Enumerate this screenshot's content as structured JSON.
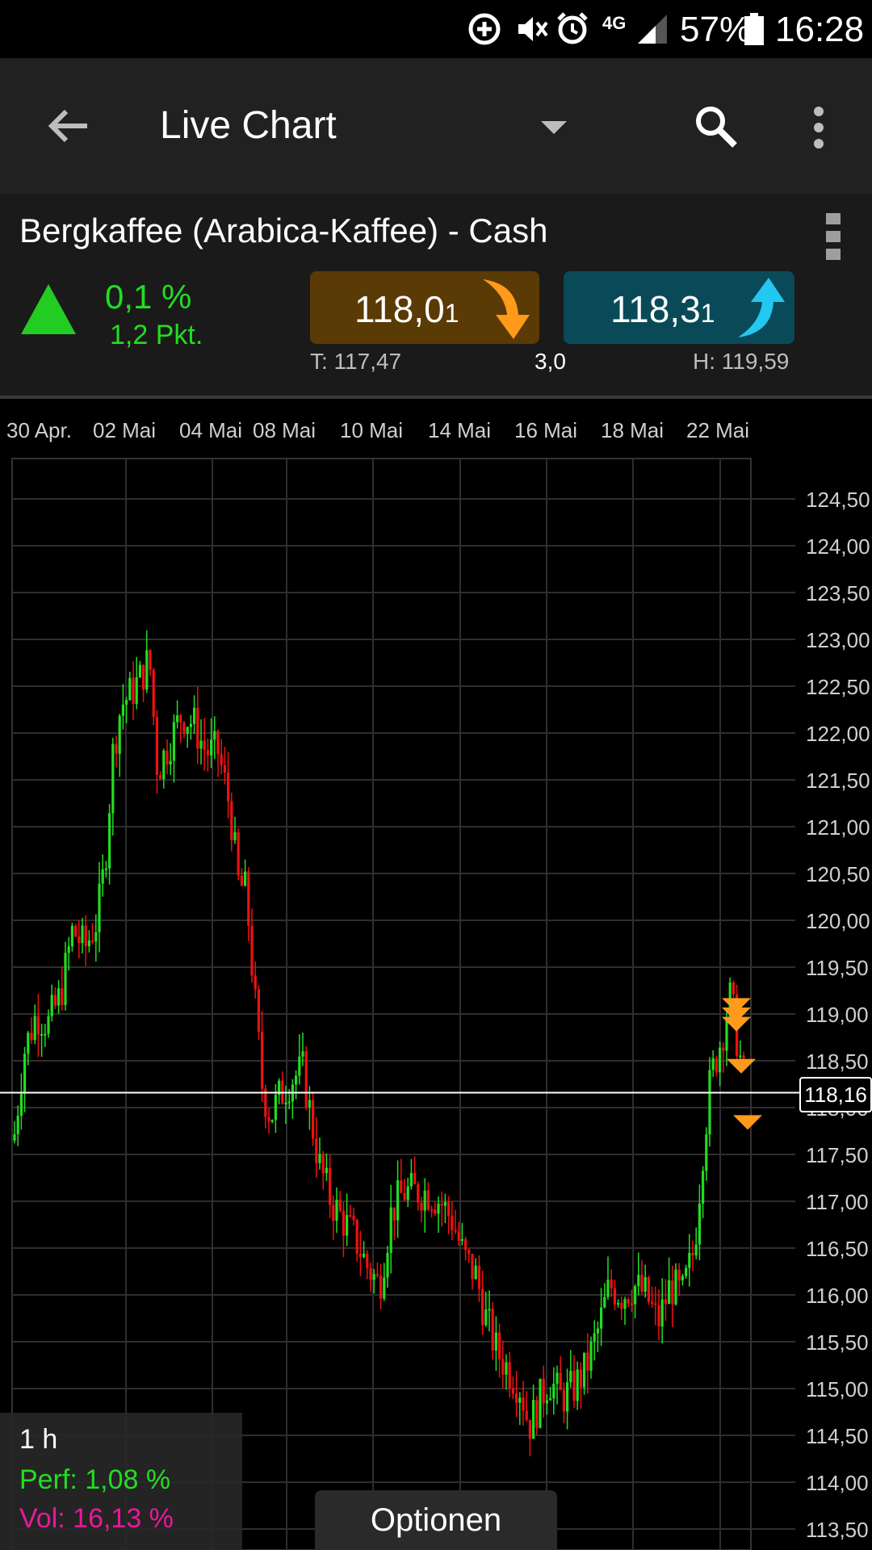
{
  "status_bar": {
    "battery": "57%",
    "time": "16:28",
    "network": "4G",
    "icons": [
      "data-saver-icon",
      "mute-icon",
      "alarm-icon",
      "signal-icon",
      "battery-icon"
    ]
  },
  "app_bar": {
    "title": "Live Chart",
    "icons": [
      "back-arrow-icon",
      "dropdown-icon",
      "search-icon",
      "more-vert-icon"
    ]
  },
  "instrument": {
    "name": "Bergkaffee (Arabica-Kaffee) - Cash",
    "change_percent": "0,1 %",
    "change_points": "1,2 Pkt.",
    "trend": "up",
    "sell_main": "118,0",
    "sell_small": "1",
    "buy_main": "118,3",
    "buy_small": "1",
    "low": "T: 117,47",
    "spread": "3,0",
    "high": "H: 119,59",
    "colors": {
      "up": "#22dd22",
      "sell_bg": "#5a3a05",
      "buy_bg": "#0a4a58",
      "sell_arrow": "#ff9a1a",
      "buy_arrow": "#22c8f0"
    }
  },
  "chart": {
    "x_labels": [
      "30 Apr.",
      "02 Mai",
      "04 Mai",
      "08 Mai",
      "10 Mai",
      "14 Mai",
      "16 Mai",
      "18 Mai",
      "22 Mai"
    ],
    "y_labels": [
      "124,50",
      "124,00",
      "123,50",
      "123,00",
      "122,50",
      "122,00",
      "121,50",
      "121,00",
      "120,50",
      "120,00",
      "119,50",
      "119,00",
      "118,50",
      "118,00",
      "117,50",
      "117,00",
      "116,50",
      "116,00",
      "115,50",
      "115,00",
      "114,50",
      "114,00",
      "113,50"
    ],
    "current_price": "118,16",
    "interval": "1 h",
    "perf": "Perf: 1,08 %",
    "vol": "Vol: 16,13 %",
    "options_label": "Optionen"
  },
  "chart_data": {
    "type": "line",
    "x": [
      "30 Apr.",
      "02 Mai",
      "04 Mai",
      "08 Mai",
      "10 Mai",
      "14 Mai",
      "16 Mai",
      "18 Mai",
      "22 Mai"
    ],
    "series": [
      {
        "values": [
          119.0,
          122.6,
          122.0,
          117.8,
          116.8,
          117.1,
          114.7,
          116.1,
          118.2
        ]
      }
    ],
    "ylim": [
      113.5,
      124.5
    ],
    "grid": true
  }
}
